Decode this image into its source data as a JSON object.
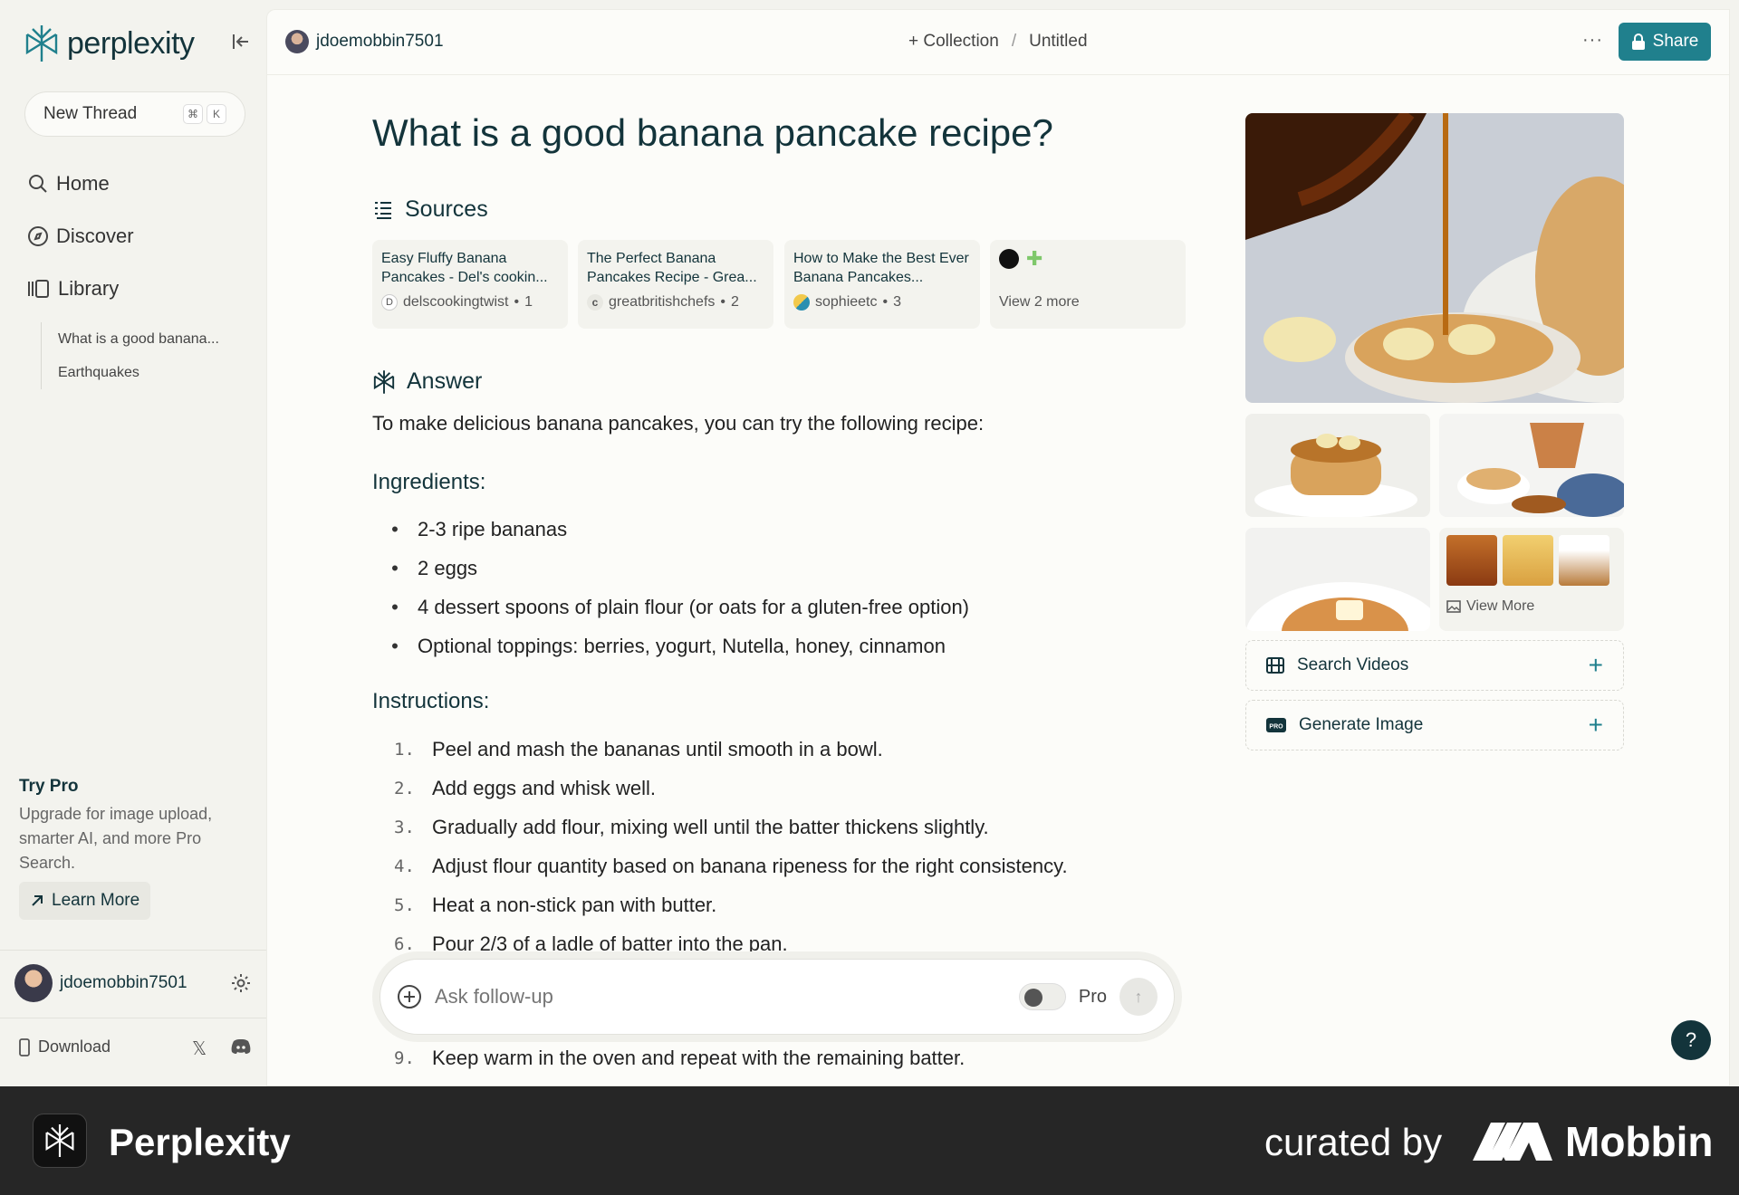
{
  "app": {
    "name": "perplexity"
  },
  "sidebar": {
    "new_thread": "New Thread",
    "shortcut": [
      "⌘",
      "K"
    ],
    "nav": [
      {
        "label": "Home",
        "icon": "search-icon"
      },
      {
        "label": "Discover",
        "icon": "compass-icon"
      },
      {
        "label": "Library",
        "icon": "library-icon"
      }
    ],
    "library_items": [
      "What is a good banana...",
      "Earthquakes"
    ],
    "try_pro": {
      "title": "Try Pro",
      "text": "Upgrade for image upload, smarter AI, and more Pro Search.",
      "button": "Learn More"
    },
    "user": "jdoemobbin7501",
    "download": "Download"
  },
  "topbar": {
    "user": "jdoemobbin7501",
    "collection": "+ Collection",
    "separator": "/",
    "thread_name": "Untitled",
    "more": "···",
    "share": "Share"
  },
  "thread": {
    "question": "What is a good banana pancake recipe?",
    "sources_heading": "Sources",
    "sources": [
      {
        "title": "Easy Fluffy Banana Pancakes - Del's cookin...",
        "site": "delscookingtwist",
        "num": "1",
        "fav_color": "#ffffff"
      },
      {
        "title": "The Perfect Banana Pancakes Recipe - Grea...",
        "site": "greatbritishchefs",
        "num": "2",
        "fav_color": "#e8e8e2"
      },
      {
        "title": "How to Make the Best Ever Banana Pancakes...",
        "site": "sophieetc",
        "num": "3",
        "fav_color": "#2a8fb0"
      }
    ],
    "sources_more": "View 2 more",
    "answer_heading": "Answer",
    "answer_intro": "To make delicious banana pancakes, you can try the following recipe:",
    "ingredients_heading": "Ingredients:",
    "ingredients": [
      "2-3 ripe bananas",
      "2 eggs",
      "4 dessert spoons of plain flour (or oats for a gluten-free option)",
      "Optional toppings: berries, yogurt, Nutella, honey, cinnamon"
    ],
    "instructions_heading": "Instructions:",
    "instructions": [
      {
        "n": "1.",
        "text": "Peel and mash the bananas until smooth in a bowl."
      },
      {
        "n": "2.",
        "text": "Add eggs and whisk well."
      },
      {
        "n": "3.",
        "text": "Gradually add flour, mixing well until the batter thickens slightly."
      },
      {
        "n": "4.",
        "text": "Adjust flour quantity based on banana ripeness for the right consistency."
      },
      {
        "n": "5.",
        "text": "Heat a non-stick pan with butter."
      },
      {
        "n": "6.",
        "text": "Pour 2/3 of a ladle of batter into the pan."
      }
    ],
    "instruction_9": {
      "n": "9.",
      "text": "Keep warm in the oven and repeat with the remaining batter."
    }
  },
  "followup": {
    "placeholder": "Ask follow-up",
    "pro_label": "Pro"
  },
  "media": {
    "view_more": "View More",
    "search_videos": "Search Videos",
    "generate_image": "Generate Image"
  },
  "help": "?",
  "footer": {
    "app_name": "Perplexity",
    "curated_by": "curated by",
    "brand": "Mobbin"
  },
  "colors": {
    "accent": "#20808d",
    "ink": "#13343b",
    "sidebar_bg": "#f3f3ee",
    "main_bg": "#fcfcf9",
    "footer_bg": "#262626"
  }
}
